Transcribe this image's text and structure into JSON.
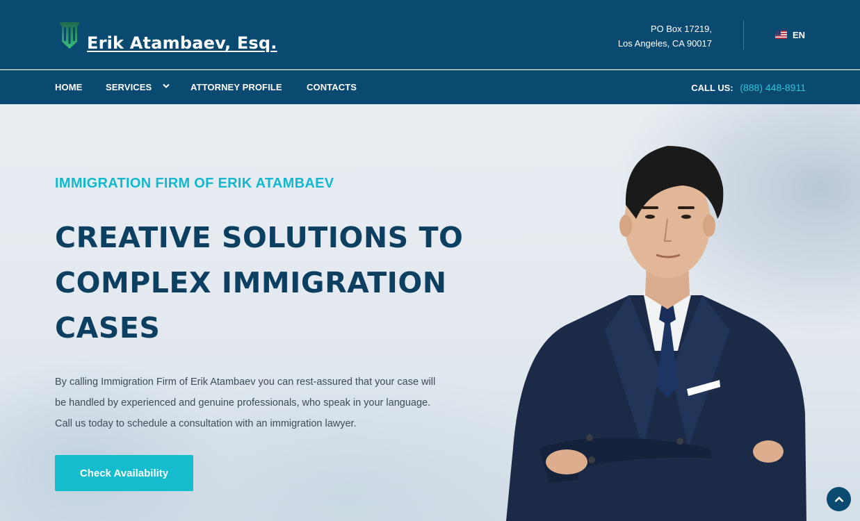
{
  "header": {
    "brand_name": "Erik Atambaev, Esq.",
    "address_line1": "PO Box 17219,",
    "address_line2": "Los Angeles, CA 90017",
    "language": "EN"
  },
  "nav": {
    "items": [
      {
        "label": "HOME"
      },
      {
        "label": "SERVICES"
      },
      {
        "label": "ATTORNEY PROFILE"
      },
      {
        "label": "CONTACTS"
      }
    ],
    "call_label": "CALL US:",
    "call_phone": "(888) 448-8911"
  },
  "hero": {
    "eyebrow": "IMMIGRATION FIRM OF ERIK ATAMBAEV",
    "headline_lines": [
      "CREATIVE SOLUTIONS TO",
      "COMPLEX IMMIGRATION",
      "CASES"
    ],
    "paragraph_lines": [
      "By calling Immigration Firm of Erik Atambaev you can rest-assured that your case will",
      "be handled by experienced and genuine professionals, who speak in your language.",
      "Call us today to schedule a consultation with an immigration lawyer."
    ],
    "cta_label": "Check Availability"
  },
  "icons": {
    "logo": "pillar-logo-icon",
    "flag": "us-flag-icon",
    "services_dropdown": "chevron-down-icon",
    "scroll_top": "chevron-up-icon"
  },
  "colors": {
    "primary_navy": "#0b4a70",
    "accent_teal": "#15bccd",
    "heading_navy": "#0c3f60"
  }
}
